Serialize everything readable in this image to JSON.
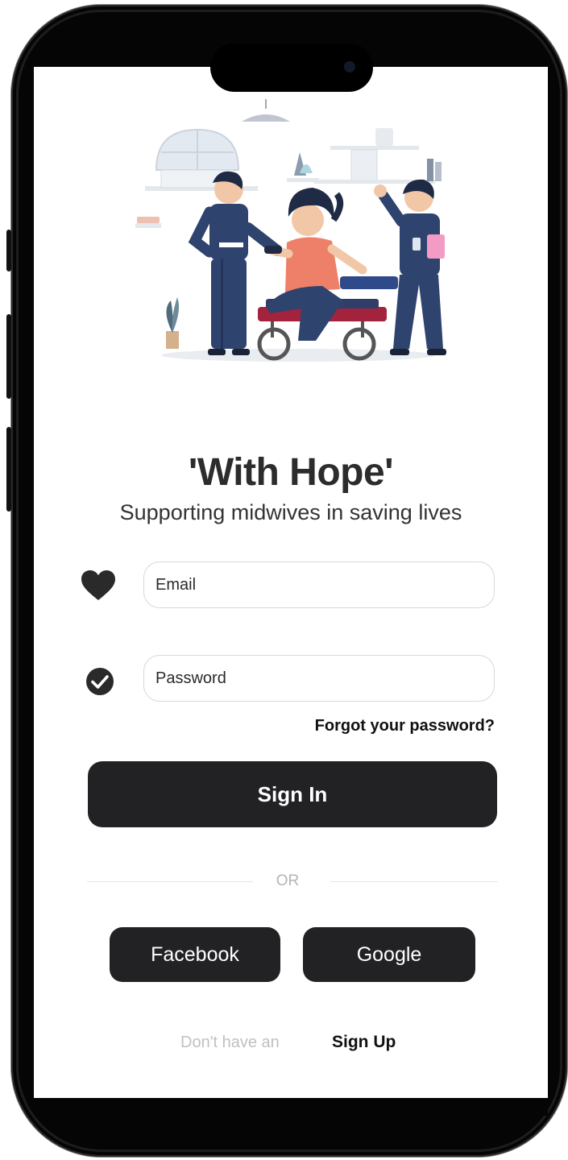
{
  "app": {
    "title": "'With Hope'",
    "subtitle": "Supporting midwives in saving lives"
  },
  "illustration": {
    "icon": "midwives-illustration"
  },
  "form": {
    "email": {
      "placeholder": "Email",
      "value": "",
      "icon": "heart-icon"
    },
    "password": {
      "placeholder": "Password",
      "value": "",
      "icon": "check-circle-icon"
    },
    "forgot_label": "Forgot your password?",
    "signin_label": "Sign In"
  },
  "divider": {
    "label": "OR"
  },
  "social": {
    "facebook_label": "Facebook",
    "google_label": "Google"
  },
  "footer": {
    "prompt": "Don't have an",
    "signup_label": "Sign Up"
  },
  "colors": {
    "button": "#222123",
    "title": "#2c2c2c",
    "muted": "#c0c0c0"
  }
}
